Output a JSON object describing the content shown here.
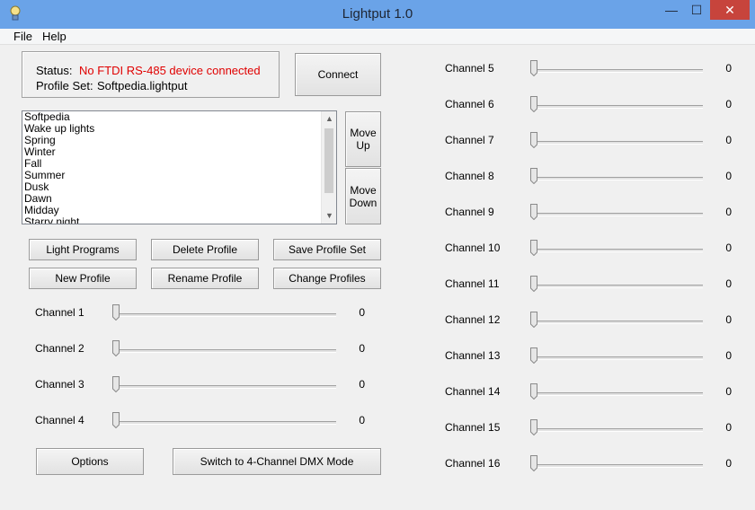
{
  "window": {
    "title": "Lightput 1.0",
    "minimize_glyph": "—",
    "maximize_glyph": "☐",
    "close_glyph": "✕",
    "app_icon": "lamp-icon"
  },
  "menu": [
    {
      "label": "File"
    },
    {
      "label": "Help"
    }
  ],
  "status": {
    "status_label": "Status:",
    "status_value": "No FTDI RS-485 device connected",
    "status_color": "#e00000",
    "profile_set_label": "Profile Set:",
    "profile_set_value": "Softpedia.lightput"
  },
  "buttons": {
    "connect": "Connect",
    "move_up": [
      "Move",
      "Up"
    ],
    "move_down": [
      "Move",
      "Down"
    ],
    "light_programs": "Light Programs",
    "delete_profile": "Delete Profile",
    "save_profile_set": "Save Profile Set",
    "new_profile": "New Profile",
    "rename_profile": "Rename Profile",
    "change_profiles": "Change Profiles",
    "options": "Options",
    "switch_mode": "Switch to 4-Channel DMX Mode"
  },
  "profiles": [
    "Softpedia",
    "Wake up lights",
    "Spring",
    "Winter",
    "Fall",
    "Summer",
    "Dusk",
    "Dawn",
    "Midday",
    "Starry night"
  ],
  "channels": [
    {
      "label": "Channel 1",
      "value": "0"
    },
    {
      "label": "Channel 2",
      "value": "0"
    },
    {
      "label": "Channel 3",
      "value": "0"
    },
    {
      "label": "Channel 4",
      "value": "0"
    },
    {
      "label": "Channel 5",
      "value": "0"
    },
    {
      "label": "Channel 6",
      "value": "0"
    },
    {
      "label": "Channel 7",
      "value": "0"
    },
    {
      "label": "Channel 8",
      "value": "0"
    },
    {
      "label": "Channel 9",
      "value": "0"
    },
    {
      "label": "Channel 10",
      "value": "0"
    },
    {
      "label": "Channel 11",
      "value": "0"
    },
    {
      "label": "Channel 12",
      "value": "0"
    },
    {
      "label": "Channel 13",
      "value": "0"
    },
    {
      "label": "Channel 14",
      "value": "0"
    },
    {
      "label": "Channel 15",
      "value": "0"
    },
    {
      "label": "Channel 16",
      "value": "0"
    }
  ],
  "scroll_arrows": {
    "up": "▲",
    "down": "▼"
  }
}
